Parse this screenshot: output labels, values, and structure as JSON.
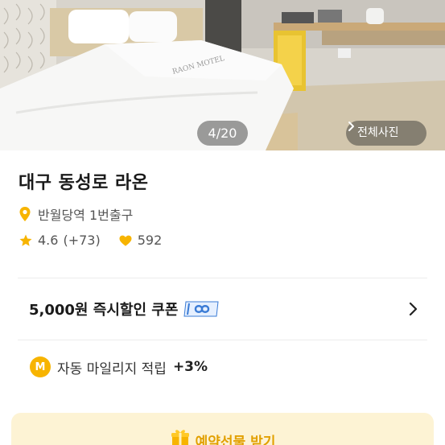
{
  "gallery": {
    "counter": "4/20",
    "all_photos_label": "전체사진",
    "bed_print": "RAON MOTEL"
  },
  "hotel": {
    "name": "대구 동성로 라온",
    "location": "반월당역 1번출구",
    "rating": "4.6",
    "review_count": "(+73)",
    "likes": "592"
  },
  "coupon": {
    "label": "5,000원 즉시할인 쿠폰"
  },
  "mileage": {
    "badge": "M",
    "label": "자동 마일리지 적립",
    "rate": "+3%"
  },
  "banner": {
    "label": "예약선물 받기"
  },
  "colors": {
    "accent_yellow": "#f7b400",
    "banner_bg": "#fdf3d4",
    "coupon_badge": "#3a7bd5"
  }
}
